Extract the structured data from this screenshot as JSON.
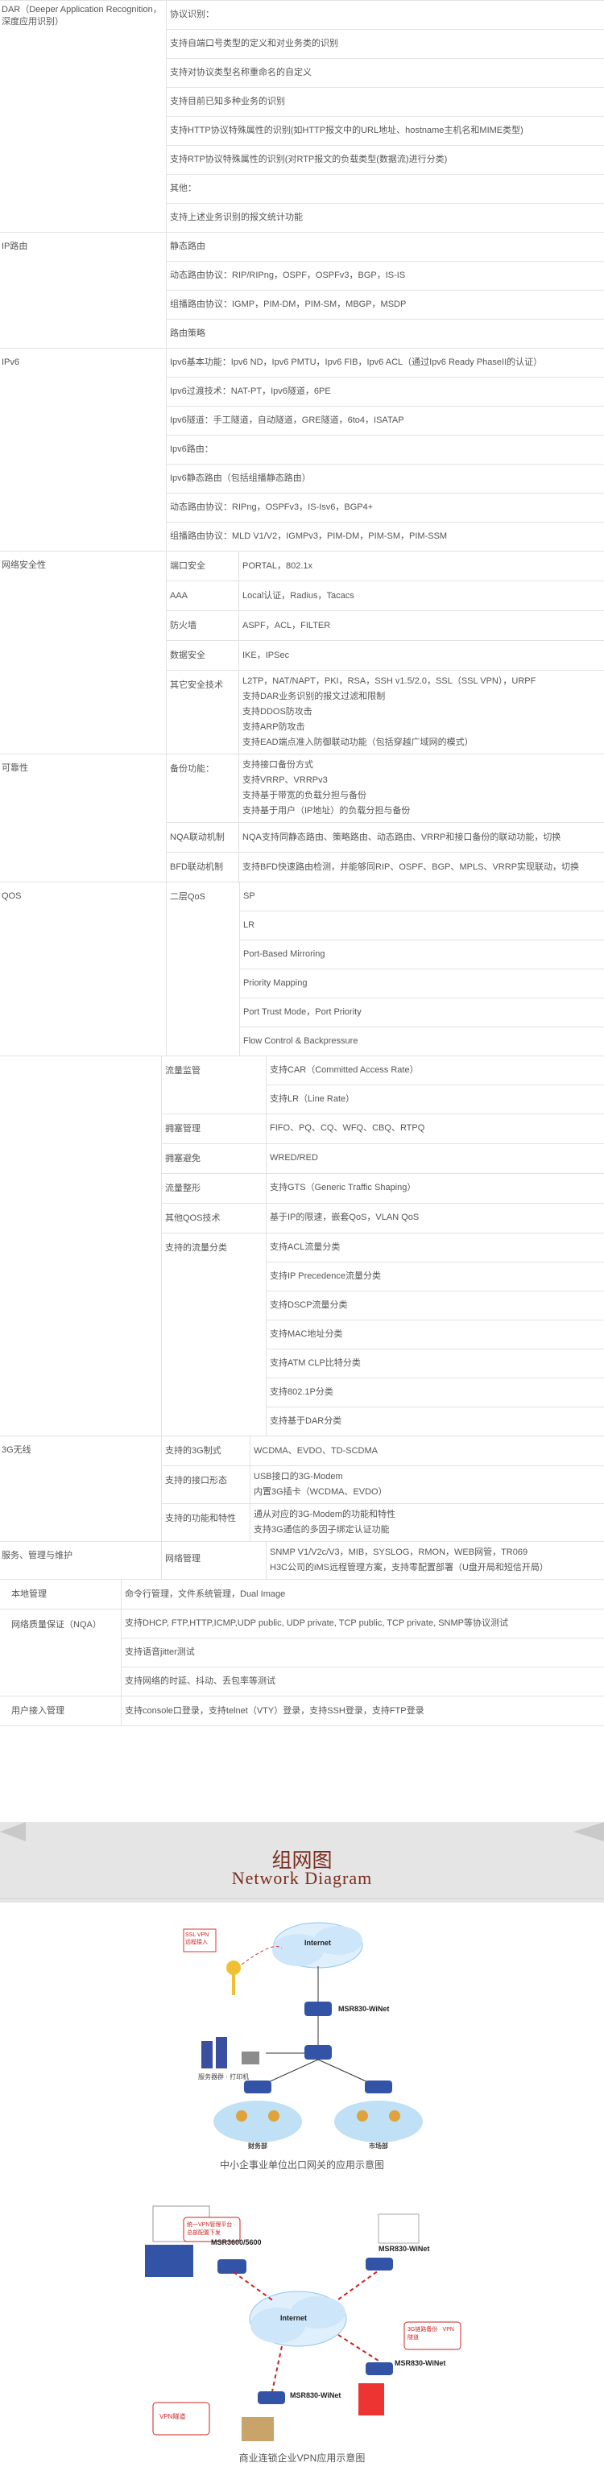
{
  "rows": {
    "dar": {
      "label": "DAR（Deeper Application Recognition，深度应用识别）",
      "items": [
        "协议识别：",
        "支持自端口号类型的定义和对业务类的识别",
        "支持对协议类型名称重命名的自定义",
        "支持目前已知多种业务的识别",
        "支持HTTP协议特殊属性的识别(如HTTP报文中的URL地址、hostname主机名和MIME类型)",
        "支持RTP协议特殊属性的识别(对RTP报文的负载类型(数据流)进行分类)",
        "其他：",
        "支持上述业务识别的报文统计功能"
      ]
    },
    "iproute": {
      "label": "IP路由",
      "items": [
        "静态路由",
        "动态路由协议：RIP/RIPng，OSPF，OSPFv3，BGP，IS-IS",
        "组播路由协议：IGMP，PIM-DM，PIM-SM，MBGP，MSDP",
        "路由策略"
      ]
    },
    "ipv6": {
      "label": "IPv6",
      "items": [
        "Ipv6基本功能：Ipv6 ND，Ipv6 PMTU，Ipv6 FIB，Ipv6 ACL（通过Ipv6 Ready PhaseII的认证）",
        "Ipv6过渡技术：NAT-PT，Ipv6隧道，6PE",
        "Ipv6隧道：手工隧道，自动隧道，GRE隧道，6to4，ISATAP",
        "Ipv6路由：",
        "Ipv6静态路由（包括组播静态路由）",
        "动态路由协议：RIPng，OSPFv3，IS-Isv6，BGP4+",
        "组播路由协议：MLD V1/V2，IGMPv3，PIM-DM，PIM-SM，PIM-SSM"
      ]
    },
    "security": {
      "label": "网络安全性",
      "subs": [
        {
          "k": "端口安全",
          "v": "PORTAL，802.1x"
        },
        {
          "k": "AAA",
          "v": "Local认证，Radius，Tacacs"
        },
        {
          "k": "防火墙",
          "v": "ASPF，ACL，FILTER"
        },
        {
          "k": "数据安全",
          "v": "IKE，IPSec"
        },
        {
          "k": "其它安全技术",
          "v": "L2TP，NAT/NAPT，PKI，RSA，SSH v1.5/2.0，SSL（SSL VPN），URPF\n支持DAR业务识别的报文过滤和限制\n支持DDOS防攻击\n支持ARP防攻击\n支持EAD端点准入防御联动功能（包括穿越广域网的模式）"
        }
      ]
    },
    "reliability": {
      "label": "可靠性",
      "subs": [
        {
          "k": "备份功能：",
          "v": "支持接口备份方式\n支持VRRP、VRRPv3\n支持基于带宽的负载分担与备份\n支持基于用户（IP地址）的负载分担与备份"
        },
        {
          "k": "NQA联动机制",
          "v": "NQA支持同静态路由、策略路由、动态路由、VRRP和接口备份的联动功能，切换"
        },
        {
          "k": "BFD联动机制",
          "v": "支持BFD快速路由检测，并能够同RIP、OSPF、BGP、MPLS、VRRP实现联动，切换"
        }
      ]
    },
    "qos": {
      "label": "QOS",
      "layer2": {
        "k": "二层QoS",
        "items": [
          "SP",
          "LR",
          "Port-Based Mirroring",
          "Priority Mapping",
          "Port Trust Mode，Port Priority",
          "Flow Control & Backpressure"
        ]
      },
      "subs": [
        {
          "k": "流量监管",
          "items": [
            "支持CAR（Committed Access Rate）",
            "支持LR（Line Rate）"
          ]
        },
        {
          "k": "拥塞管理",
          "items": [
            "FIFO、PQ、CQ、WFQ、CBQ、RTPQ"
          ]
        },
        {
          "k": "拥塞避免",
          "items": [
            "WRED/RED"
          ]
        },
        {
          "k": "流量整形",
          "items": [
            "支持GTS（Generic Traffic Shaping）"
          ]
        },
        {
          "k": "其他QOS技术",
          "items": [
            "基于IP的限速，嵌套QoS，VLAN QoS"
          ]
        },
        {
          "k": "支持的流量分类",
          "items": [
            "支持ACL流量分类",
            "支持IP Precedence流量分类",
            "支持DSCP流量分类",
            "支持MAC地址分类",
            "支持ATM CLP比特分类",
            "支持802.1P分类",
            "支持基于DAR分类"
          ]
        }
      ]
    },
    "wireless": {
      "label": "3G无线",
      "subs": [
        {
          "k": "支持的3G制式",
          "v": "WCDMA、EVDO、TD-SCDMA"
        },
        {
          "k": "支持的接口形态",
          "v": "USB接口的3G-Modem\n内置3G插卡（WCDMA、EVDO）"
        },
        {
          "k": "支持的功能和特性",
          "v": "通从对应的3G-Modem的功能和特性\n支持3G通信的多因子绑定认证功能"
        }
      ]
    },
    "mgmt": {
      "label": "服务、管理与维护",
      "k": "网络管理",
      "v": "SNMP V1/V2c/V3，MIB，SYSLOG，RMON，WEB网管，TR069\nH3C公司的iMS远程管理方案，支持零配置部署（U盘开局和短信开局）"
    },
    "local": {
      "label": "本地管理",
      "v": "命令行管理，文件系统管理，Dual Image"
    },
    "nqa": {
      "label": "网络质量保证（NQA）",
      "items": [
        "支持DHCP, FTP,HTTP,ICMP,UDP public, UDP private, TCP public, TCP private, SNMP等协议测试",
        "支持语音jitter测试",
        "支持网络的时延、抖动、丢包率等测试"
      ]
    },
    "access": {
      "label": "用户接入管理",
      "v": "支持console口登录，支持telnet（VTY）登录，支持SSH登录，支持FTP登录"
    }
  },
  "banner": {
    "title": "组网图",
    "subtitle": "Network Diagram"
  },
  "diagram1": {
    "caption": "中小企事业单位出口网关的应用示意图",
    "internet": "Internet",
    "router": "MSR830-WiNet",
    "sslvpn": "SSL VPN 远程接入",
    "servers": "服务器群 · 打印机",
    "dept_left": "财务部",
    "dept_right": "市场部"
  },
  "diagram2": {
    "caption": "商业连锁企业VPN应用示意图",
    "internet": "Internet",
    "hq_router": "MSR3600/5600",
    "branch1": "MSR830-WiNet",
    "branch2": "MSR830-WiNet",
    "branch3": "MSR830-WiNet",
    "note_top": "统一VPN管理平台 · 总部配置下发",
    "note_right": "3G链路备份 · VPN隧道",
    "note_left": "VPN隧道"
  }
}
